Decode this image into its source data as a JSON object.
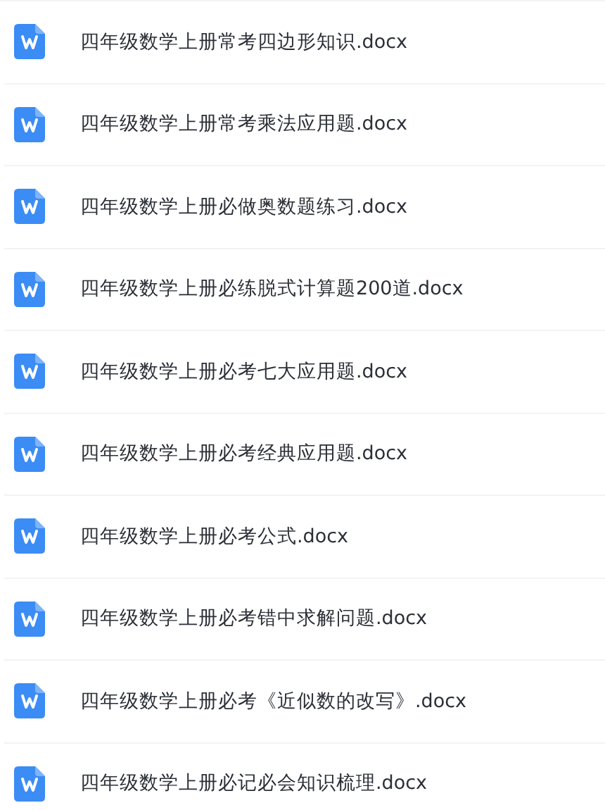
{
  "files": [
    {
      "name": "四年级数学上册常考四边形知识.docx"
    },
    {
      "name": "四年级数学上册常考乘法应用题.docx"
    },
    {
      "name": "四年级数学上册必做奥数题练习.docx"
    },
    {
      "name": "四年级数学上册必练脱式计算题200道.docx"
    },
    {
      "name": "四年级数学上册必考七大应用题.docx"
    },
    {
      "name": "四年级数学上册必考经典应用题.docx"
    },
    {
      "name": "四年级数学上册必考公式.docx"
    },
    {
      "name": "四年级数学上册必考错中求解问题.docx"
    },
    {
      "name": "四年级数学上册必考《近似数的改写》.docx"
    },
    {
      "name": "四年级数学上册必记必会知识梳理.docx"
    }
  ]
}
